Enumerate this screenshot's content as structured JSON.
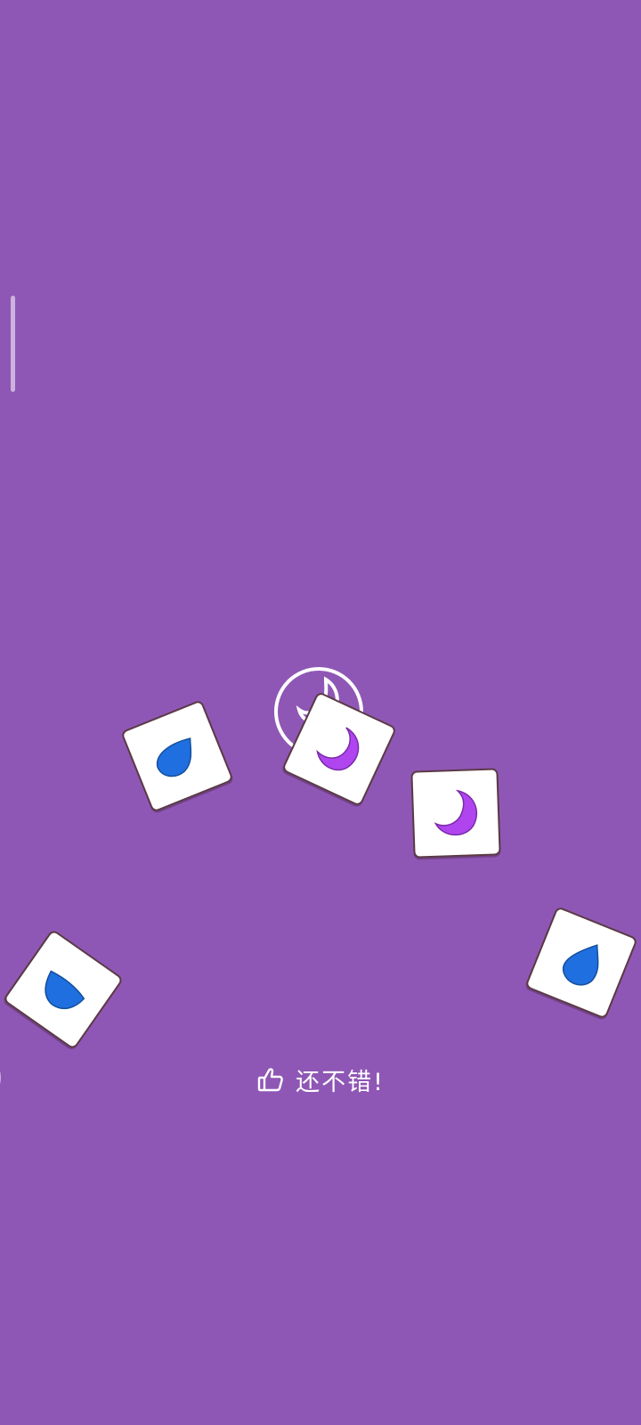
{
  "colors": {
    "background": "#8f57b5",
    "tile_face": "#ffffff",
    "tile_border": "#5b3a46",
    "drop_blue": "#1f6fe0",
    "moon_purple": "#b045f0"
  },
  "board": {
    "tiles": [
      {
        "symbol": "drop-icon"
      },
      {
        "symbol": "moon-icon"
      },
      {
        "symbol": "moon-icon"
      },
      {
        "symbol": "drop-icon"
      },
      {
        "symbol": "drop-icon"
      }
    ]
  },
  "feedback": {
    "icon": "thumbs-up-icon",
    "text": "还不错!"
  }
}
